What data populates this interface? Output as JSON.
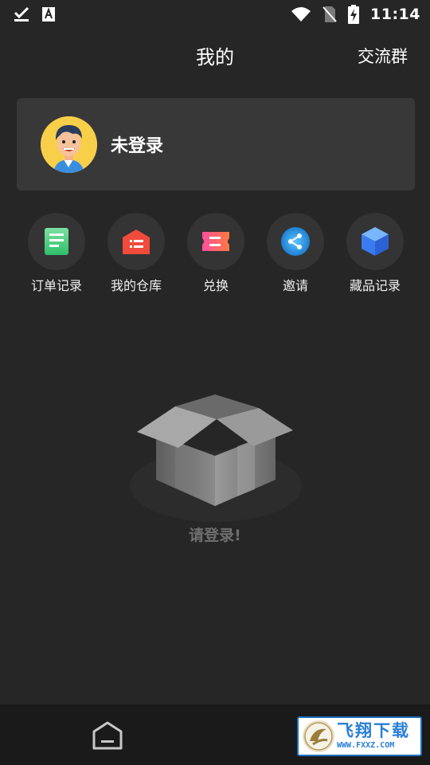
{
  "status_bar": {
    "time": "11:14",
    "icons": [
      "download-done-icon",
      "font-a-icon",
      "wifi-icon",
      "no-sim-icon",
      "battery-charging-icon"
    ]
  },
  "header": {
    "title": "我的",
    "group_link": "交流群"
  },
  "profile": {
    "login_label": "未登录",
    "avatar_icon": "cartoon-avatar"
  },
  "quick_menu": [
    {
      "label": "订单记录",
      "icon": "order-list-icon",
      "color": "#3fcf7a"
    },
    {
      "label": "我的仓库",
      "icon": "warehouse-icon",
      "color": "#f04b3b"
    },
    {
      "label": "兑换",
      "icon": "ticket-icon",
      "color": "#ff4f86"
    },
    {
      "label": "邀请",
      "icon": "share-icon",
      "color": "#2a9be0"
    },
    {
      "label": "藏品记录",
      "icon": "cube-icon",
      "color": "#3a7cf0"
    }
  ],
  "empty_state": {
    "text": "请登录!",
    "icon": "empty-box-icon"
  },
  "bottom_nav": {
    "home_icon": "home-icon",
    "watermark_cn": "飞翔下载",
    "watermark_en": "WWW.FXXZ.COM"
  }
}
